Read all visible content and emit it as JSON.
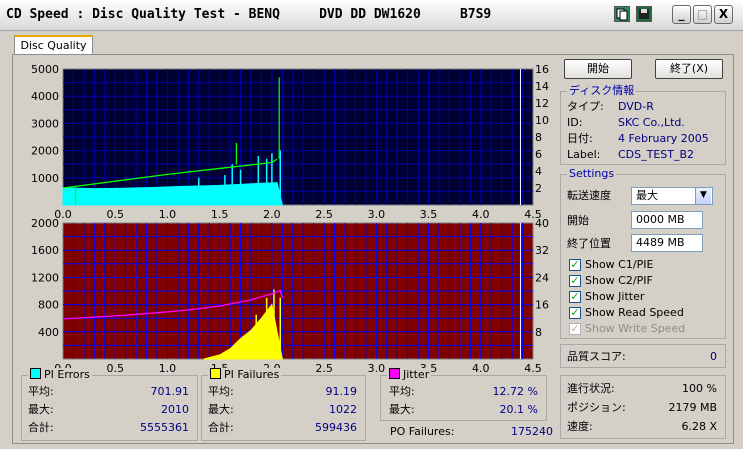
{
  "window": {
    "title": "CD Speed : Disc Quality Test - BENQ     DVD DD DW1620     B7S9",
    "min_glyph": "_",
    "max_glyph": "□",
    "close_glyph": "X"
  },
  "tabs": [
    {
      "label": "Disc Quality"
    }
  ],
  "buttons": {
    "start": "開始",
    "end": "終了(X)"
  },
  "disc_info": {
    "title": "ディスク情報",
    "rows": [
      {
        "label": "タイプ:",
        "value": "DVD-R"
      },
      {
        "label": "ID:",
        "value": "SKC Co.,Ltd."
      },
      {
        "label": "日付:",
        "value": "4 February 2005"
      },
      {
        "label": "Label:",
        "value": "CDS_TEST_B2"
      }
    ]
  },
  "settings": {
    "title": "Settings",
    "speed_label": "転送速度",
    "speed_value": "最大",
    "start_label": "開始",
    "start_value": "0000 MB",
    "end_label": "終了位置",
    "end_value": "4489 MB",
    "checks": [
      {
        "label": "Show C1/PIE",
        "checked": true,
        "enabled": true
      },
      {
        "label": "Show C2/PIF",
        "checked": true,
        "enabled": true
      },
      {
        "label": "Show Jitter",
        "checked": true,
        "enabled": true
      },
      {
        "label": "Show Read Speed",
        "checked": true,
        "enabled": true
      },
      {
        "label": "Show Write Speed",
        "checked": true,
        "enabled": false
      }
    ]
  },
  "quality": {
    "label": "品質スコア:",
    "value": "0"
  },
  "progress": {
    "rows": [
      {
        "label": "進行状況:",
        "value": "100 %"
      },
      {
        "label": "ポジション:",
        "value": "2179 MB"
      },
      {
        "label": "速度:",
        "value": "6.28 X"
      }
    ]
  },
  "stats": {
    "pi_errors": {
      "title": "PI Errors",
      "color": "#00ffff",
      "rows": [
        {
          "label": "平均:",
          "value": "701.91"
        },
        {
          "label": "最大:",
          "value": "2010"
        },
        {
          "label": "合計:",
          "value": "5555361"
        }
      ]
    },
    "pi_failures": {
      "title": "PI Failures",
      "color": "#ffff00",
      "rows": [
        {
          "label": "平均:",
          "value": "91.19"
        },
        {
          "label": "最大:",
          "value": "1022"
        },
        {
          "label": "合計:",
          "value": "599436"
        }
      ]
    },
    "jitter": {
      "title": "Jitter",
      "color": "#ff00ff",
      "rows": [
        {
          "label": "平均:",
          "value": "12.72 %"
        },
        {
          "label": "最大:",
          "value": "20.1 %"
        }
      ]
    },
    "po_failures": {
      "label": "PO Failures:",
      "value": "175240"
    }
  },
  "chart_data": [
    {
      "type": "area",
      "name": "top",
      "background": "#000033",
      "grid_color": "#0000aa",
      "x_ticks": [
        "0.0",
        "0.5",
        "1.0",
        "1.5",
        "2.0",
        "2.5",
        "3.0",
        "3.5",
        "4.0",
        "4.5"
      ],
      "xlim": [
        0,
        4.5
      ],
      "ylim_left": [
        0,
        5000
      ],
      "y_ticks_left": [
        "5000",
        "4000",
        "3000",
        "2000",
        "1000"
      ],
      "ylim_right": [
        0,
        16
      ],
      "y_ticks_right": [
        "16",
        "14",
        "12",
        "10",
        "8",
        "6",
        "4",
        "2"
      ],
      "grid": true,
      "end_marker_x": 4.38,
      "pie_series": {
        "color": "#00ffff",
        "x": [
          0.0,
          0.1,
          0.3,
          0.5,
          0.7,
          0.9,
          1.1,
          1.3,
          1.5,
          1.7,
          1.9,
          2.05,
          2.1
        ],
        "values": [
          640,
          620,
          600,
          610,
          630,
          650,
          680,
          700,
          720,
          760,
          800,
          820,
          0
        ]
      },
      "pie_spikes": [
        {
          "x": 1.3,
          "value": 1000
        },
        {
          "x": 1.55,
          "value": 1100
        },
        {
          "x": 1.62,
          "value": 1500
        },
        {
          "x": 1.7,
          "value": 1300
        },
        {
          "x": 1.87,
          "value": 1800
        },
        {
          "x": 1.95,
          "value": 1700
        },
        {
          "x": 2.0,
          "value": 1900
        },
        {
          "x": 2.08,
          "value": 2010
        }
      ],
      "read_speed_series": {
        "color": "#00ff00",
        "x": [
          0.0,
          0.5,
          1.0,
          1.5,
          2.0,
          2.05
        ],
        "values": [
          2.0,
          2.8,
          3.6,
          4.3,
          5.0,
          5.4
        ]
      },
      "read_speed_spikes": [
        {
          "x": 0.12,
          "value": 0.1
        },
        {
          "x": 1.66,
          "value": 7.3
        },
        {
          "x": 2.07,
          "value": 15.0
        }
      ]
    },
    {
      "type": "area",
      "name": "bottom",
      "background": "#800000",
      "grid_color": "#0000ff",
      "x_ticks": [
        "0.0",
        "0.5",
        "1.0",
        "1.5",
        "2.0",
        "2.5",
        "3.0",
        "3.5",
        "4.0",
        "4.5"
      ],
      "xlim": [
        0,
        4.5
      ],
      "ylim_left": [
        0,
        2000
      ],
      "y_ticks_left": [
        "2000",
        "1600",
        "1200",
        "800",
        "400"
      ],
      "ylim_right": [
        0,
        40
      ],
      "y_ticks_right": [
        "40",
        "32",
        "24",
        "16",
        "8"
      ],
      "grid": true,
      "end_marker_x": 4.38,
      "pif_series": {
        "color": "#ffff00",
        "x": [
          1.35,
          1.5,
          1.6,
          1.7,
          1.8,
          1.9,
          2.0,
          2.1
        ],
        "values": [
          0,
          60,
          150,
          300,
          420,
          600,
          800,
          0
        ]
      },
      "pif_spikes": [
        {
          "x": 1.85,
          "value": 650
        },
        {
          "x": 1.95,
          "value": 900
        },
        {
          "x": 2.02,
          "value": 1022
        },
        {
          "x": 2.08,
          "value": 900
        }
      ],
      "jitter_series": {
        "color": "#ff00ff",
        "x": [
          0.0,
          0.3,
          0.6,
          0.9,
          1.2,
          1.5,
          1.8,
          2.0,
          2.08,
          2.1
        ],
        "values": [
          11.8,
          12.3,
          12.9,
          13.6,
          14.4,
          15.6,
          17.4,
          19.2,
          20.1,
          18.0
        ]
      }
    }
  ]
}
